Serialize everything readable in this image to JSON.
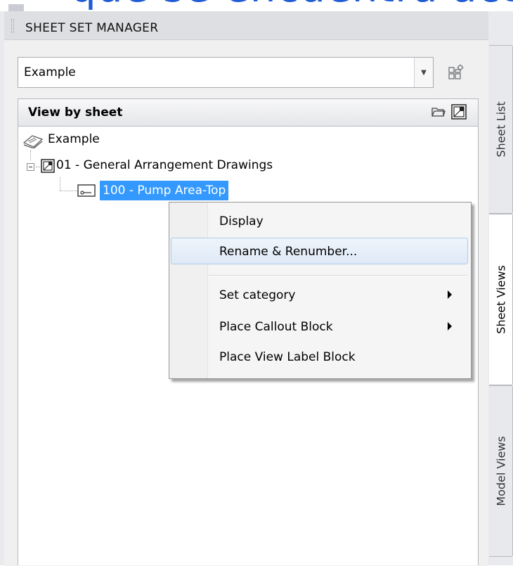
{
  "banner_text": "que se encuentra activa.",
  "palette": {
    "title": "SHEET SET MANAGER"
  },
  "sheet_set_selector": {
    "value": "Example"
  },
  "view_header": {
    "label": "View by sheet"
  },
  "tree": {
    "root": "Example",
    "subset": "01 - General Arrangement Drawings",
    "selected_item": "100 - Pump Area-Top"
  },
  "context_menu": {
    "items": [
      {
        "label": "Display",
        "has_submenu": false
      },
      {
        "label": "Rename & Renumber...",
        "has_submenu": false,
        "highlighted": true
      },
      {
        "label": "Set category",
        "has_submenu": true
      },
      {
        "label": "Place Callout Block",
        "has_submenu": true
      },
      {
        "label": "Place View Label Block",
        "has_submenu": false
      }
    ]
  },
  "tabs": [
    {
      "label": "Sheet List",
      "active": false
    },
    {
      "label": "Sheet Views",
      "active": true
    },
    {
      "label": "Model Views",
      "active": false
    }
  ],
  "colors": {
    "selection": "#3399ff",
    "banner_text": "#1e5bd4"
  }
}
